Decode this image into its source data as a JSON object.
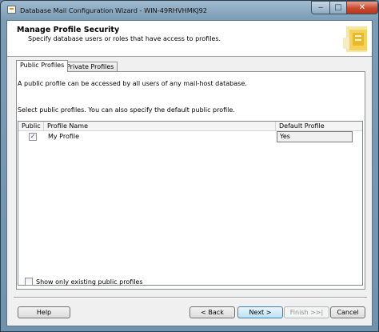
{
  "window": {
    "title": "Database Mail Configuration Wizard - WIN-49RHVHMKJ92",
    "min_glyph": "‒",
    "max_glyph": "□",
    "close_glyph": "✕"
  },
  "header": {
    "title": "Manage Profile Security",
    "subtitle": "Specify database users or roles that have access to profiles."
  },
  "tabs": [
    {
      "label": "Public Profiles",
      "selected": true
    },
    {
      "label": "Private Profiles",
      "selected": false
    }
  ],
  "panel": {
    "description": "A public profile can be accessed by all users of any mail-host database.",
    "instruction": "Select public profiles. You can also specify the default public profile."
  },
  "grid": {
    "columns": [
      "Public",
      "Profile Name",
      "Default Profile"
    ],
    "rows": [
      {
        "public": true,
        "check_glyph": "✓",
        "name": "My Profile",
        "default": "Yes"
      }
    ]
  },
  "show_existing": {
    "label": "Show only existing public profiles",
    "checked": false
  },
  "buttons": {
    "help": "Help",
    "back": "< Back",
    "next": "Next >",
    "finish": "Finish >>|",
    "cancel": "Cancel"
  }
}
